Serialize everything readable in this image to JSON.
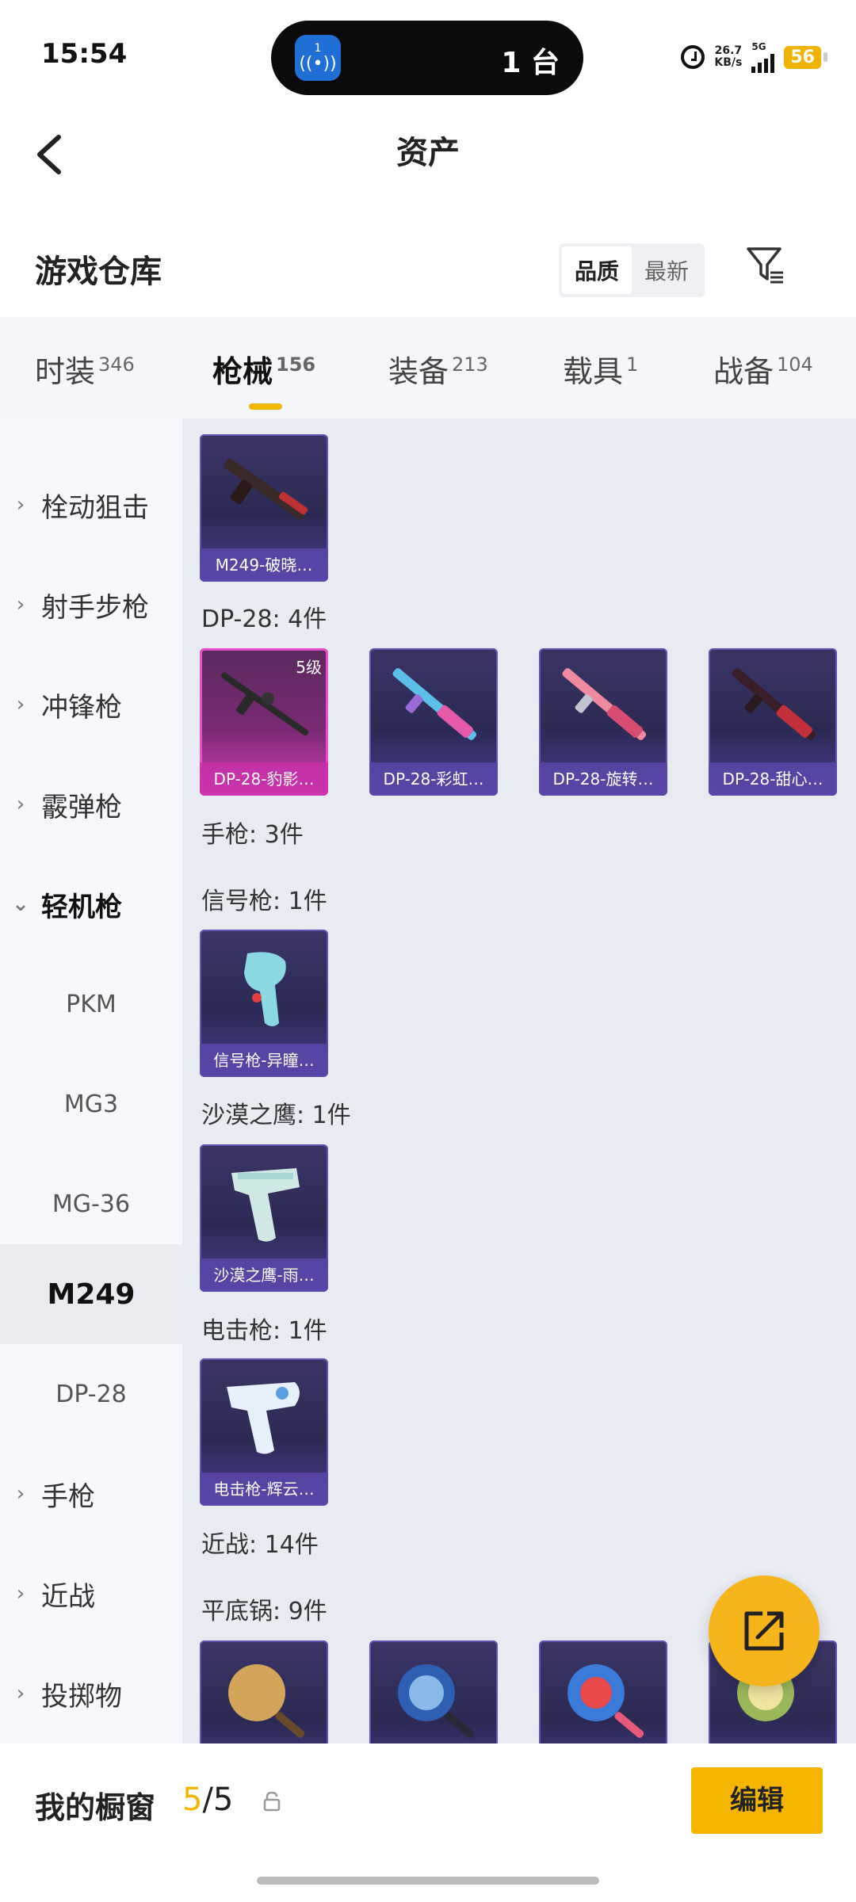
{
  "status_bar": {
    "time": "15:54",
    "island_badge": "1",
    "island_text": "1 台",
    "net_speed_value": "26.7",
    "net_speed_unit": "KB/s",
    "network": "5G",
    "battery": "56"
  },
  "header": {
    "title": "资产"
  },
  "warehouse": {
    "title": "游戏仓库",
    "sort_options": [
      "品质",
      "最新"
    ],
    "active_sort": "品质"
  },
  "tabs": [
    {
      "label": "时装",
      "count": "346"
    },
    {
      "label": "枪械",
      "count": "156"
    },
    {
      "label": "装备",
      "count": "213"
    },
    {
      "label": "载具",
      "count": "1"
    },
    {
      "label": "战备",
      "count": "104"
    }
  ],
  "active_tab": "枪械",
  "sidebar": {
    "groups": [
      "栓动狙击",
      "射手步枪",
      "冲锋枪",
      "霰弹枪",
      "轻机枪"
    ],
    "subitems": [
      "PKM",
      "MG3",
      "MG-36",
      "M249",
      "DP-28"
    ],
    "groups_after": [
      "手枪",
      "近战",
      "投掷物"
    ],
    "selected": "M249"
  },
  "content": {
    "m249_items": [
      "M249-破晓…"
    ],
    "dp28_label": "DP-28: 4件",
    "dp28_items": [
      {
        "name": "DP-28-豹影…",
        "level": "5级"
      },
      {
        "name": "DP-28-彩虹…"
      },
      {
        "name": "DP-28-旋转…"
      },
      {
        "name": "DP-28-甜心…"
      }
    ],
    "pistol_label": "手枪: 3件",
    "flare_label": "信号枪: 1件",
    "flare_items": [
      "信号枪-异瞳…"
    ],
    "deagle_label": "沙漠之鹰: 1件",
    "deagle_items": [
      "沙漠之鹰-雨…"
    ],
    "taser_label": "电击枪: 1件",
    "taser_items": [
      "电击枪-辉云…"
    ],
    "melee_label": "近战: 14件",
    "pan_label": "平底锅: 9件"
  },
  "bottom_bar": {
    "showcase_label": "我的橱窗",
    "count_current": "5",
    "count_total": "/5",
    "edit_label": "编辑"
  },
  "colors": {
    "accent": "#f5b400",
    "card_purple": "#3b3566",
    "card_pink": "#d63fb9"
  }
}
